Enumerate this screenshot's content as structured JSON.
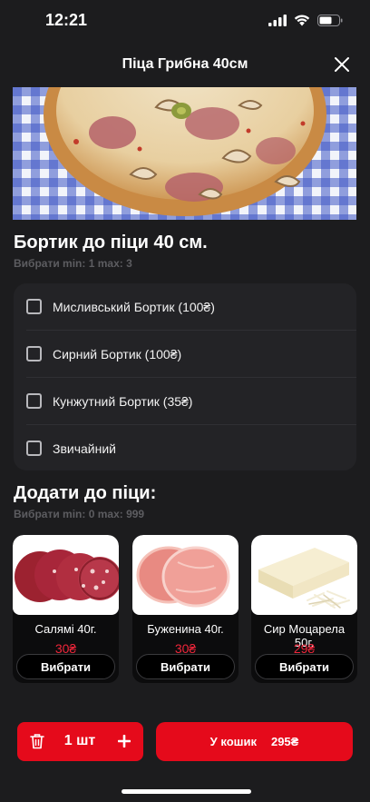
{
  "status_bar": {
    "time": "12:21"
  },
  "header": {
    "title": "Піца Грибна 40см"
  },
  "crust_section": {
    "title": "Бортик до піци 40 см.",
    "limits": "Вибрати min: 1 max: 3",
    "options": [
      {
        "label": "Мисливський Бортик (100₴)",
        "checked": false
      },
      {
        "label": "Сирний Бортик (100₴)",
        "checked": false
      },
      {
        "label": "Кунжутний Бортик (35₴)",
        "checked": false
      },
      {
        "label": "Звичайний",
        "checked": false
      }
    ]
  },
  "addons_section": {
    "title": "Додати до піци:",
    "limits": "Вибрати min: 0 max: 999",
    "items": [
      {
        "name": "Салямі 40г.",
        "price": "30₴",
        "button": "Вибрати"
      },
      {
        "name": "Буженина 40г.",
        "price": "30₴",
        "button": "Вибрати"
      },
      {
        "name": "Сир Моцарела 50г.",
        "price": "29₴",
        "button": "Вибрати"
      }
    ]
  },
  "cart": {
    "quantity": "1 шт",
    "add_label": "У кошик",
    "total": "295₴"
  },
  "colors": {
    "accent": "#e50a1b",
    "price": "#f0263a",
    "background": "#1c1c1e",
    "card": "#232326"
  }
}
